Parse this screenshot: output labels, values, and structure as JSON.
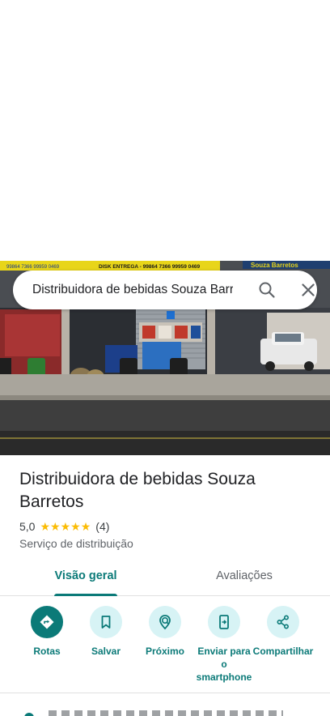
{
  "search": {
    "query": "Distribuidora de bebidas Souza Barretos"
  },
  "photo": {
    "banner_text_left": "99864 7366  99959 0469",
    "banner_text_mid": "DISK ENTREGA - 99864 7366  99959 0469",
    "banner_text_right": "Souza Barretos"
  },
  "place": {
    "name": "Distribuidora de bebidas Souza Barretos",
    "rating": "5,0",
    "stars": 5,
    "review_count": "(4)",
    "category": "Serviço de distribuição"
  },
  "tabs": [
    {
      "label": "Visão geral",
      "active": true
    },
    {
      "label": "Avaliações",
      "active": false
    }
  ],
  "actions": [
    {
      "label": "Rotas",
      "icon": "directions-icon"
    },
    {
      "label": "Salvar",
      "icon": "bookmark-icon"
    },
    {
      "label": "Próximo",
      "icon": "nearby-icon"
    },
    {
      "label": "Enviar para o smartphone",
      "icon": "send-to-phone-icon"
    },
    {
      "label": "Compartilhar",
      "icon": "share-icon"
    }
  ],
  "colors": {
    "accent": "#0b7a78",
    "accent_light": "#d7f3f5",
    "star": "#fbbc04"
  }
}
